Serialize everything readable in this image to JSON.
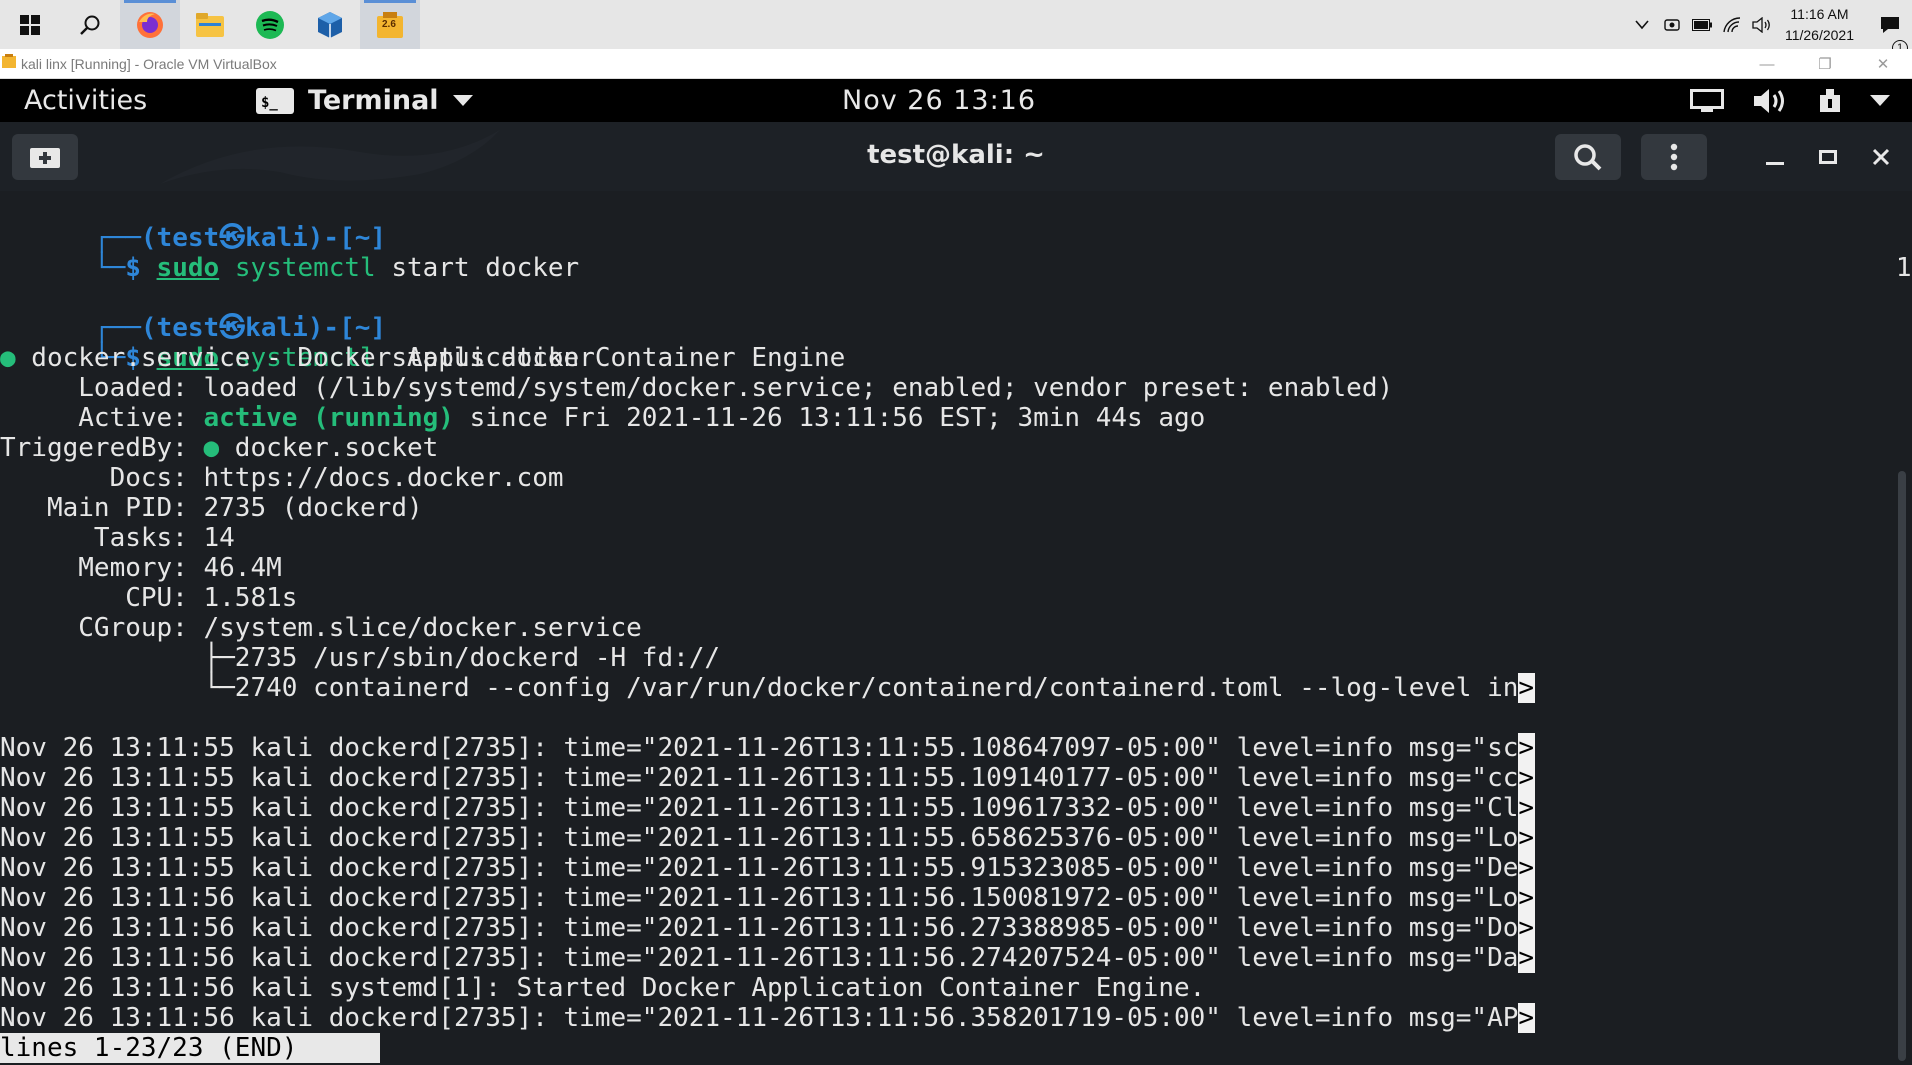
{
  "windows_taskbar": {
    "apps": [
      "start-icon",
      "search-icon",
      "firefox-icon",
      "file-explorer-icon",
      "spotify-icon",
      "virtualbox-icon",
      "vm-session-icon"
    ],
    "vm_session_badge": "2.6",
    "clock": {
      "time": "11:16 AM",
      "date": "11/26/2021"
    },
    "notifications_count": "1"
  },
  "vbox": {
    "title": "kali linx [Running] - Oracle VM VirtualBox"
  },
  "gnome": {
    "activities": "Activities",
    "app_name": "Terminal",
    "clock": "Nov 26  13:16"
  },
  "terminal": {
    "title": "test@kali: ~",
    "exit_code": "1",
    "exit_mark": "✕",
    "prompt_top": "┌──(",
    "prompt_user": "test㉿kali",
    "prompt_dir": ")-[~]",
    "prompt_bottom": "└─$ ",
    "cmd1": {
      "sudo": "sudo",
      "systemctl": "systemctl",
      "rest": " start docker"
    },
    "cmd2": {
      "sudo": "sudo",
      "systemctl": "systemctl",
      "rest": " status docker"
    },
    "status": {
      "dot": "●",
      "service": " docker.service - Docker Application Container Engine",
      "loaded": "     Loaded: loaded (/lib/systemd/system/docker.service; enabled; vendor preset: enabled)",
      "active_label": "     Active: ",
      "active_state": "active (running)",
      "active_rest": " since Fri 2021-11-26 13:11:56 EST; 3min 44s ago",
      "triggered_label": "TriggeredBy: ",
      "triggered_rest": " docker.socket",
      "docs": "       Docs: https://docs.docker.com",
      "main_pid": "   Main PID: 2735 (dockerd)",
      "tasks": "      Tasks: 14",
      "memory": "     Memory: 46.4M",
      "cpu": "        CPU: 1.581s",
      "cgroup": "     CGroup: /system.slice/docker.service",
      "cg1": "             ├─2735 /usr/sbin/dockerd -H fd://",
      "cg2": "             └─2740 containerd --config /var/run/docker/containerd/containerd.toml --log-level in"
    },
    "overflow_mark": ">",
    "logs": [
      "Nov 26 13:11:55 kali dockerd[2735]: time=\"2021-11-26T13:11:55.108647097-05:00\" level=info msg=\"sc",
      "Nov 26 13:11:55 kali dockerd[2735]: time=\"2021-11-26T13:11:55.109140177-05:00\" level=info msg=\"cc",
      "Nov 26 13:11:55 kali dockerd[2735]: time=\"2021-11-26T13:11:55.109617332-05:00\" level=info msg=\"Cl",
      "Nov 26 13:11:55 kali dockerd[2735]: time=\"2021-11-26T13:11:55.658625376-05:00\" level=info msg=\"Lo",
      "Nov 26 13:11:55 kali dockerd[2735]: time=\"2021-11-26T13:11:55.915323085-05:00\" level=info msg=\"De",
      "Nov 26 13:11:56 kali dockerd[2735]: time=\"2021-11-26T13:11:56.150081972-05:00\" level=info msg=\"Lo",
      "Nov 26 13:11:56 kali dockerd[2735]: time=\"2021-11-26T13:11:56.273388985-05:00\" level=info msg=\"Do",
      "Nov 26 13:11:56 kali dockerd[2735]: time=\"2021-11-26T13:11:56.274207524-05:00\" level=info msg=\"Da",
      "Nov 26 13:11:56 kali systemd[1]: Started Docker Application Container Engine.",
      "Nov 26 13:11:56 kali dockerd[2735]: time=\"2021-11-26T13:11:56.358201719-05:00\" level=info msg=\"AP"
    ],
    "pager_status": "lines 1-23/23 (END)"
  }
}
